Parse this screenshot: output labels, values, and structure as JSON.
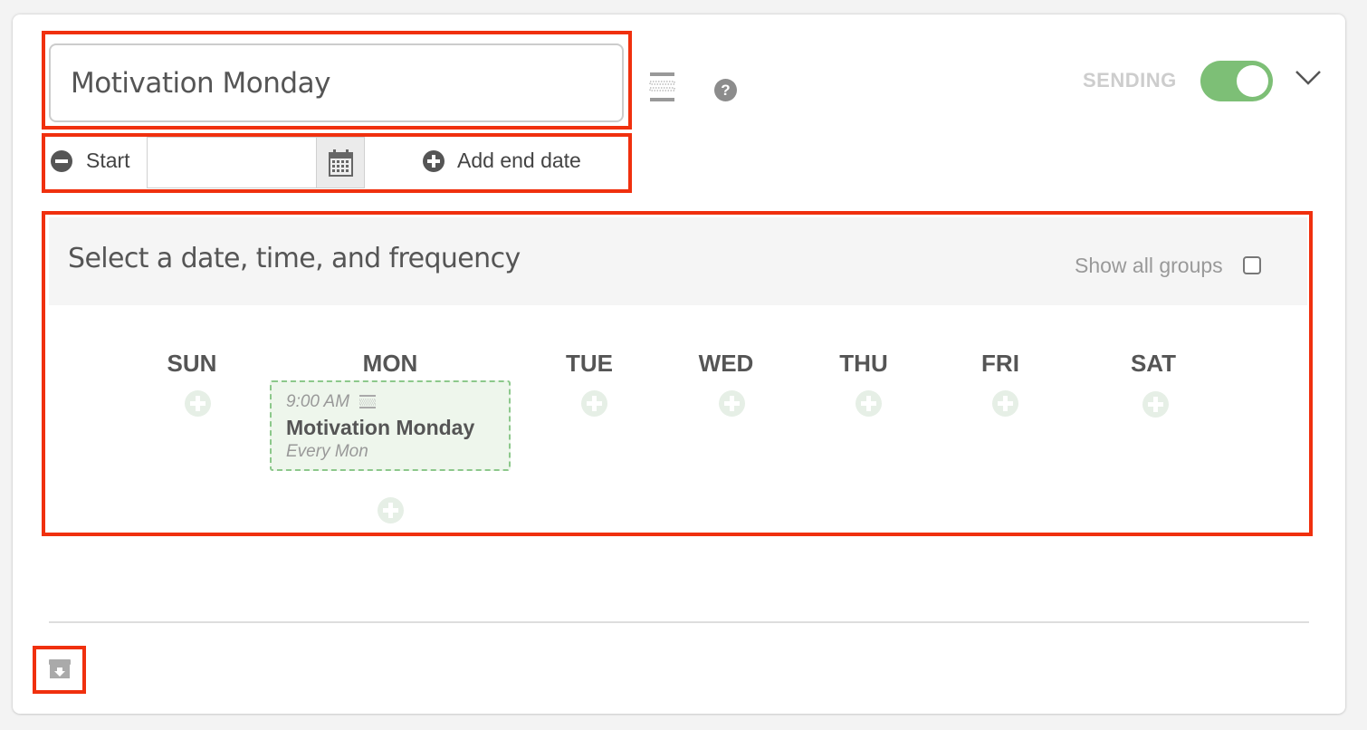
{
  "campaign": {
    "title_value": "Motivation Monday",
    "status_label": "SENDING",
    "sending_enabled": true,
    "help_symbol": "?"
  },
  "schedule_range": {
    "start_label": "Start",
    "start_date_value": "",
    "add_end_date_label": "Add end date"
  },
  "scheduler": {
    "heading": "Select a date, time, and frequency",
    "show_all_groups_label": "Show all groups",
    "show_all_groups_checked": false,
    "days": [
      "SUN",
      "MON",
      "TUE",
      "WED",
      "THU",
      "FRI",
      "SAT"
    ],
    "events": [
      {
        "day": "MON",
        "time": "9:00 AM",
        "title": "Motivation Monday",
        "frequency": "Every Mon"
      }
    ]
  },
  "icons": {
    "wrap": "text-wrap-icon",
    "help": "help-icon",
    "expand": "chevron-down-icon",
    "remove_start": "minus-circle-icon",
    "calendar": "calendar-icon",
    "add_end": "plus-circle-icon",
    "add_slot": "plus-circle-icon",
    "archive": "archive-icon"
  },
  "colors": {
    "highlight": "#f0300e",
    "toggle_on": "#7dbf76",
    "event_border": "#8cc88b",
    "event_bg": "#eef6ec"
  }
}
